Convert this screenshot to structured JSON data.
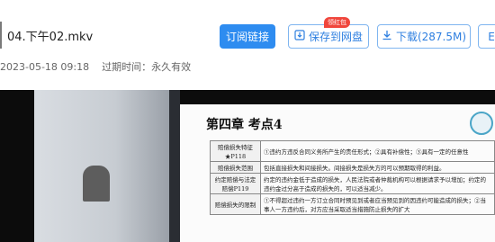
{
  "file": {
    "name": "04.下午02.mkv",
    "datetime": "2023-05-18 09:18",
    "expiry_label": "过期时间：",
    "expiry_value": "永久有效"
  },
  "toolbar": {
    "subscribe_label": "订阅链接",
    "save_label": "保存到网盘",
    "download_label": "下载(287.5M)",
    "more_label": "E",
    "redpack_label": "领红包"
  },
  "slide": {
    "title": "第四章  考点4",
    "rows": [
      {
        "key": "赔偿损失特征 ★P118",
        "value": "①违约方违反合同义务所产生的责任形式；②具有补偿性；③具有一定的任意性"
      },
      {
        "key": "赔偿损失范围",
        "value": "包括直接损失和间接损失。间接损失是损失方的可以预期取得的利益。"
      },
      {
        "key": "约定赔偿与法定赔偿P119",
        "value": "约定的违约金低于造成的损失，人民法院或者仲裁机构可以根据请求予以增加；约定的违约金过分高于造成的损失的，可以适当减少。"
      },
      {
        "key": "赔偿损失的限制",
        "value": "①不得超过违约一方订立合同时预见到或者应当预见到的因违约可能造成的损失；②当事人一方违约后，对方应当采取适当措施防止损失的扩大"
      }
    ]
  }
}
